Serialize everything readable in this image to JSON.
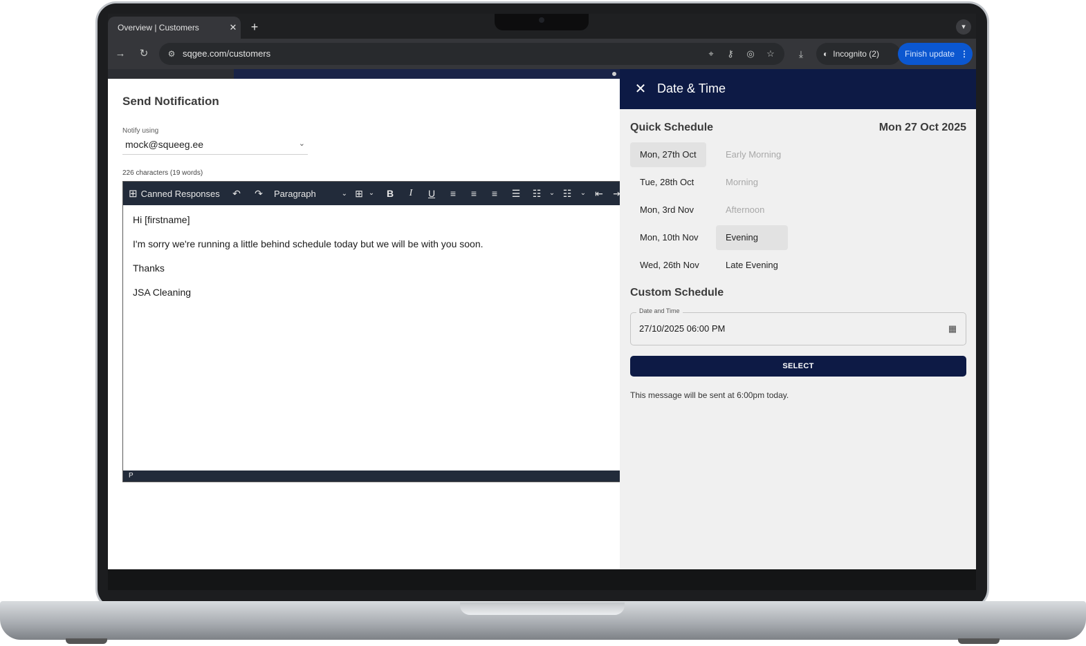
{
  "browser": {
    "tab_title": "Overview | Customers",
    "tab_close": "✕",
    "new_tab": "+",
    "url": "sqgee.com/customers",
    "incognito_label": "Incognito (2)",
    "finish_update_label": "Finish update"
  },
  "notification": {
    "title": "Send Notification",
    "notify_label": "Notify using",
    "notify_value": "mock@squeeg.ee",
    "char_count": "226 characters (19 words)"
  },
  "editor": {
    "toolbar": {
      "canned_responses_label": "Canned Responses",
      "paragraph_label": "Paragraph"
    },
    "paragraphs": [
      "Hi [firstname]",
      "I'm sorry we're running a little behind schedule today but we will be with you soon.",
      "Thanks",
      "JSA Cleaning"
    ],
    "status_path": "P"
  },
  "drawer": {
    "title": "Date & Time",
    "quick_schedule_title": "Quick Schedule",
    "current_date": "Mon 27 Oct 2025",
    "days": [
      "Mon, 27th Oct",
      "Tue, 28th Oct",
      "Mon, 3rd Nov",
      "Mon, 10th Nov",
      "Wed, 26th Nov"
    ],
    "selected_day": "Mon, 27th Oct",
    "times": [
      {
        "label": "Early Morning",
        "disabled": true
      },
      {
        "label": "Morning",
        "disabled": true
      },
      {
        "label": "Afternoon",
        "disabled": true
      },
      {
        "label": "Evening",
        "disabled": false
      },
      {
        "label": "Late Evening",
        "disabled": false
      }
    ],
    "selected_time": "Evening",
    "custom_schedule_title": "Custom Schedule",
    "datetime_label": "Date and Time",
    "datetime_value": "27/10/2025 06:00 PM",
    "select_button": "SELECT",
    "send_note": "This message will be sent at 6:00pm today."
  },
  "colors": {
    "drawer_header": "#0d1a45",
    "toolbar": "#222b3a",
    "chrome_accent": "#0b57d0"
  }
}
